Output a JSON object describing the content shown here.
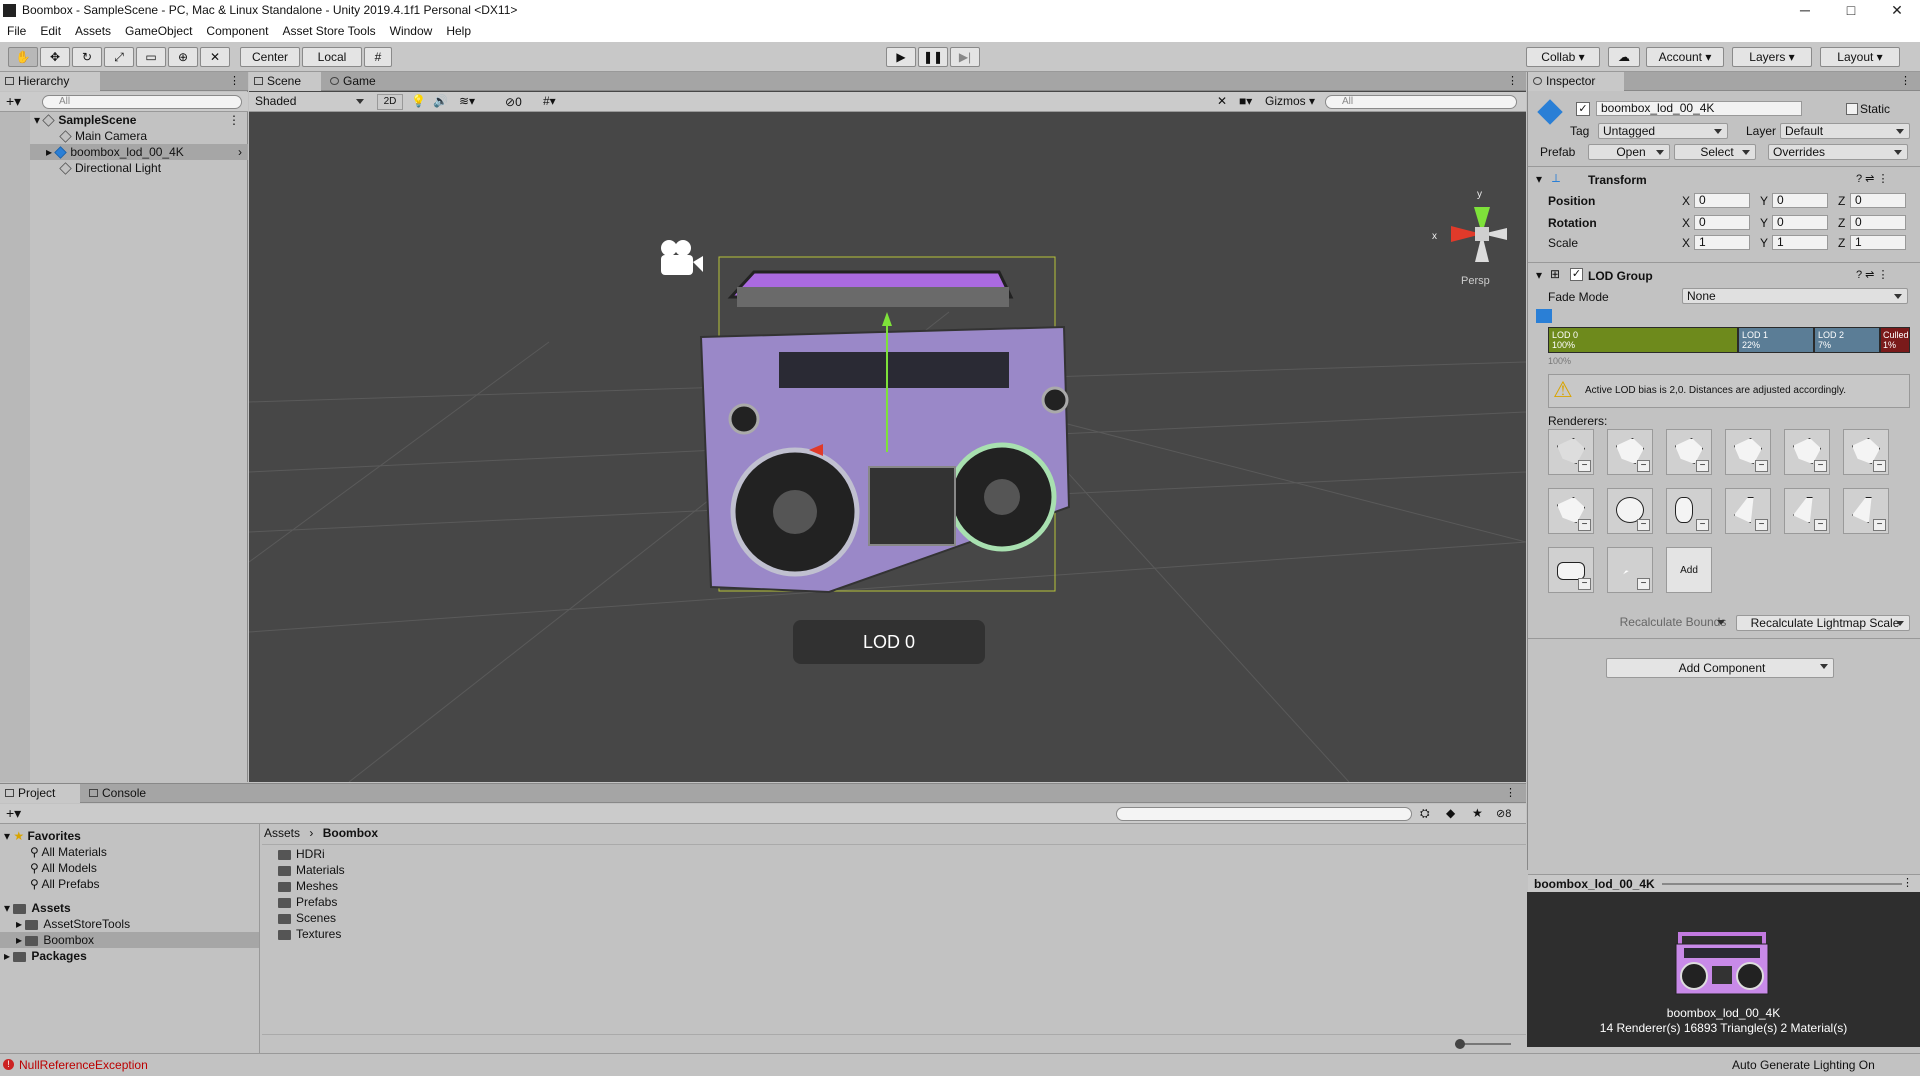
{
  "window": {
    "title": "Boombox - SampleScene - PC, Mac & Linux Standalone - Unity 2019.4.1f1 Personal <DX11>",
    "minimize": "─",
    "maximize": "□",
    "close": "✕"
  },
  "menu": [
    "File",
    "Edit",
    "Assets",
    "GameObject",
    "Component",
    "Asset Store Tools",
    "Window",
    "Help"
  ],
  "toolbar": {
    "center": "Center",
    "local": "Local",
    "collab": "Collab",
    "account": "Account",
    "layers": "Layers",
    "layout": "Layout"
  },
  "hierarchy": {
    "tab": "Hierarchy",
    "search_placeholder": "All",
    "scene": "SampleScene",
    "items": [
      "Main Camera",
      "boombox_lod_00_4K",
      "Directional Light"
    ]
  },
  "scene": {
    "tabs": [
      "Scene",
      "Game"
    ],
    "shading": "Shaded",
    "mode2d": "2D",
    "hidden_count": "0",
    "gizmos": "Gizmos",
    "search_placeholder": "All",
    "persp": "Persp",
    "axis_x": "x",
    "axis_y": "y",
    "lod_overlay": "LOD 0"
  },
  "inspector": {
    "tab": "Inspector",
    "object_name": "boombox_lod_00_4K",
    "static": "Static",
    "tag_label": "Tag",
    "tag": "Untagged",
    "layer_label": "Layer",
    "layer": "Default",
    "prefab_label": "Prefab",
    "open": "Open",
    "select": "Select",
    "overrides": "Overrides",
    "transform": {
      "title": "Transform",
      "position": "Position",
      "rotation": "Rotation",
      "scale": "Scale",
      "x": "X",
      "y": "Y",
      "z": "Z",
      "pos": [
        "0",
        "0",
        "0"
      ],
      "rot": [
        "0",
        "0",
        "0"
      ],
      "scl": [
        "1",
        "1",
        "1"
      ]
    },
    "lod": {
      "title": "LOD Group",
      "fade_mode_label": "Fade Mode",
      "fade_mode": "None",
      "levels": [
        {
          "name": "LOD 0",
          "pct": "100%",
          "color": "#6e8a1c"
        },
        {
          "name": "LOD 1",
          "pct": "22%",
          "color": "#5b7d96"
        },
        {
          "name": "LOD 2",
          "pct": "7%",
          "color": "#5b7d96"
        },
        {
          "name": "Culled",
          "pct": "1%",
          "color": "#7a1a1a"
        }
      ],
      "scale_label": "100%",
      "warning": "Active LOD bias is 2,0. Distances are adjusted accordingly.",
      "renderers_label": "Renderers:",
      "add": "Add",
      "recalc_bounds": "Recalculate Bounds",
      "recalc_lightmap": "Recalculate Lightmap Scale"
    },
    "add_component": "Add Component"
  },
  "preview": {
    "title": "boombox_lod_00_4K",
    "name": "boombox_lod_00_4K",
    "stats": "14 Renderer(s)   16893 Triangle(s)   2 Material(s)"
  },
  "project": {
    "tabs": [
      "Project",
      "Console"
    ],
    "favorites": "Favorites",
    "fav_items": [
      "All Materials",
      "All Models",
      "All Prefabs"
    ],
    "assets": "Assets",
    "asset_items": [
      "AssetStoreTools",
      "Boombox"
    ],
    "packages": "Packages",
    "breadcrumb": [
      "Assets",
      "Boombox"
    ],
    "folders": [
      "HDRi",
      "Materials",
      "Meshes",
      "Prefabs",
      "Scenes",
      "Textures"
    ],
    "hidden_count": "8"
  },
  "status": {
    "error": "NullReferenceException",
    "right": "Auto Generate Lighting On"
  }
}
